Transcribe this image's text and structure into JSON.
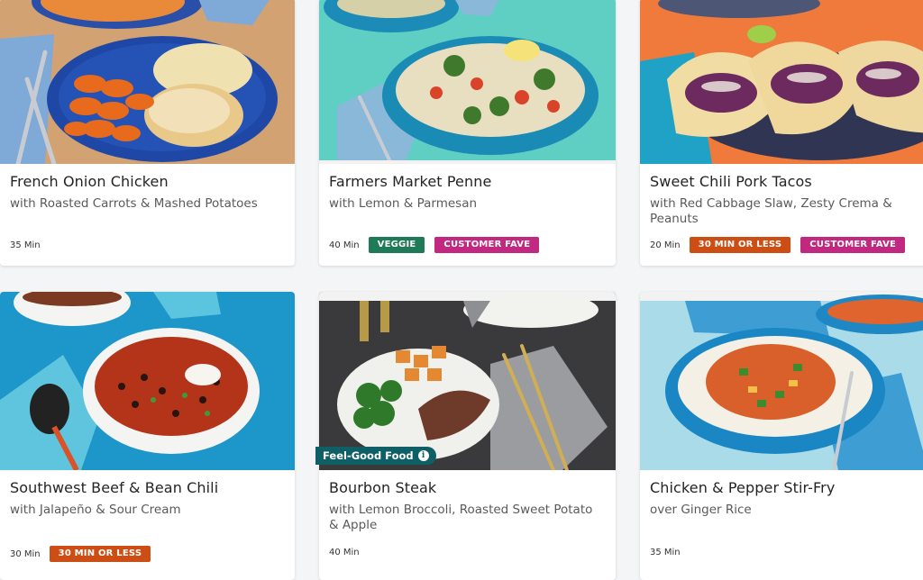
{
  "meals": [
    {
      "title": "French Onion Chicken",
      "subtitle": "with Roasted Carrots & Mashed Potatoes",
      "time": "35 Min",
      "tags": []
    },
    {
      "title": "Farmers Market Penne",
      "subtitle": "with Lemon & Parmesan",
      "time": "40 Min",
      "tags": [
        "VEGGIE",
        "CUSTOMER FAVE"
      ]
    },
    {
      "title": "Sweet Chili Pork Tacos",
      "subtitle": "with Red Cabbage Slaw, Zesty Crema & Peanuts",
      "time": "20 Min",
      "tags": [
        "30 MIN OR LESS",
        "CUSTOMER FAVE"
      ]
    },
    {
      "title": "Southwest Beef & Bean Chili",
      "subtitle": "with Jalapeño & Sour Cream",
      "time": "30 Min",
      "tags": [
        "30 MIN OR LESS"
      ]
    },
    {
      "title": "Bourbon Steak",
      "subtitle": "with Lemon Broccoli, Roasted Sweet Potato & Apple",
      "time": "40 Min",
      "tags": []
    },
    {
      "title": "Chicken & Pepper Stir-Fry",
      "subtitle": "over Ginger Rice",
      "time": "35 Min",
      "tags": []
    }
  ],
  "feel_good_label": "Feel-Good Food",
  "colors": {
    "veggie": "#1e7a57",
    "customer_fave": "#c0297f",
    "thirty_min": "#cc4e14",
    "feel_good": "#0f5f66"
  }
}
